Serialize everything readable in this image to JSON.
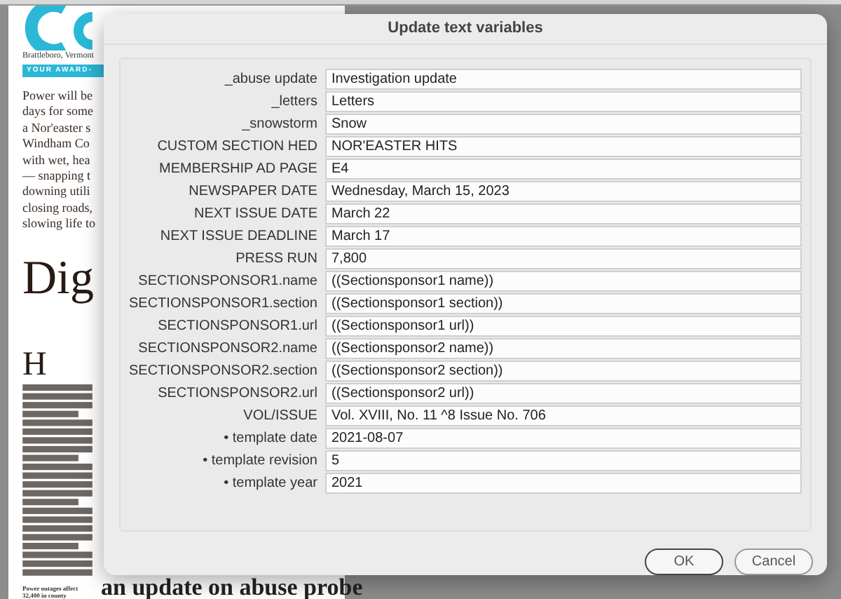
{
  "newspaper": {
    "dateline": "Brattleboro, Vermont",
    "banner": "YOUR AWARD-",
    "lead_lines": [
      "Power will be",
      "days for some",
      "a Nor'easter s",
      "Windham Co",
      "with wet, hea",
      "— snapping t",
      "downing utili",
      "closing roads,",
      "slowing life to"
    ],
    "headline": "Dig",
    "drop_cap": "H",
    "caption": "Power outages affect 32,400 in county",
    "bottom_headline": "an update on abuse probe"
  },
  "dialog": {
    "title": "Update text variables",
    "variables": [
      {
        "label": "_abuse update",
        "value": "Investigation update"
      },
      {
        "label": "_letters",
        "value": "Letters"
      },
      {
        "label": "_snowstorm",
        "value": "Snow"
      },
      {
        "label": "CUSTOM SECTION HED",
        "value": "NOR'EASTER HITS"
      },
      {
        "label": "MEMBERSHIP AD PAGE",
        "value": "E4"
      },
      {
        "label": "NEWSPAPER DATE",
        "value": "Wednesday, March 15, 2023"
      },
      {
        "label": "NEXT ISSUE DATE",
        "value": "March 22"
      },
      {
        "label": "NEXT ISSUE DEADLINE",
        "value": "March 17"
      },
      {
        "label": "PRESS RUN",
        "value": "7,800"
      },
      {
        "label": "SECTIONSPONSOR1.name",
        "value": "((Sectionsponsor1 name))"
      },
      {
        "label": "SECTIONSPONSOR1.section",
        "value": "((Sectionsponsor1 section))"
      },
      {
        "label": "SECTIONSPONSOR1.url",
        "value": "((Sectionsponsor1 url))"
      },
      {
        "label": "SECTIONSPONSOR2.name",
        "value": "((Sectionsponsor2 name))"
      },
      {
        "label": "SECTIONSPONSOR2.section",
        "value": "((Sectionsponsor2 section))"
      },
      {
        "label": "SECTIONSPONSOR2.url",
        "value": "((Sectionsponsor2 url))"
      },
      {
        "label": "VOL/ISSUE",
        "value": "Vol. XVIII, No. 11 ^8 Issue No. 706"
      },
      {
        "label": "• template date",
        "value": "2021-08-07"
      },
      {
        "label": "• template revision",
        "value": "5"
      },
      {
        "label": "• template year",
        "value": "2021"
      }
    ],
    "buttons": [
      {
        "label": "OK",
        "kind": "default"
      },
      {
        "label": "Cancel",
        "kind": "normal"
      }
    ]
  }
}
